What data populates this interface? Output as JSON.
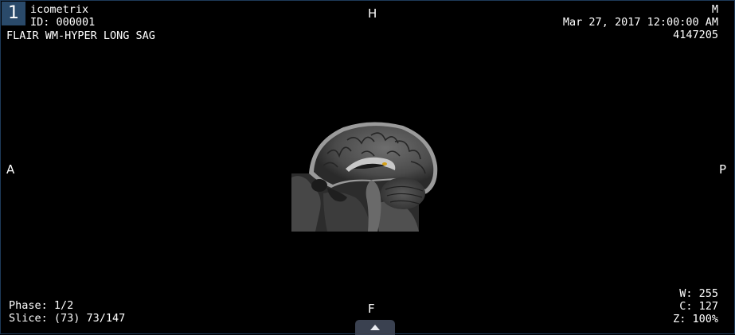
{
  "viewport": {
    "number": "1"
  },
  "overlay": {
    "top_left": {
      "institution": "icometrix",
      "patient_id": "ID: 000001",
      "series_description": "FLAIR WM-HYPER LONG SAG"
    },
    "top_right": {
      "orientation_marker": "M",
      "datetime": "Mar 27, 2017 12:00:00 AM",
      "accession": "4147205"
    },
    "bottom_left": {
      "phase": "Phase: 1/2",
      "slice": "Slice: (73) 73/147"
    },
    "bottom_right": {
      "window_width": "W: 255",
      "window_center": "C: 127",
      "zoom": "Z: 100%"
    },
    "orientation": {
      "top": "H",
      "left": "A",
      "right": "P",
      "bottom": "F"
    }
  },
  "icons": {
    "expand": "triangle-up-icon"
  },
  "colors": {
    "viewport_border": "#1e3a5a",
    "badge_bg": "#2a4a6a",
    "lesion_highlight": "#d4a017",
    "tab_bg": "#3a4150"
  }
}
